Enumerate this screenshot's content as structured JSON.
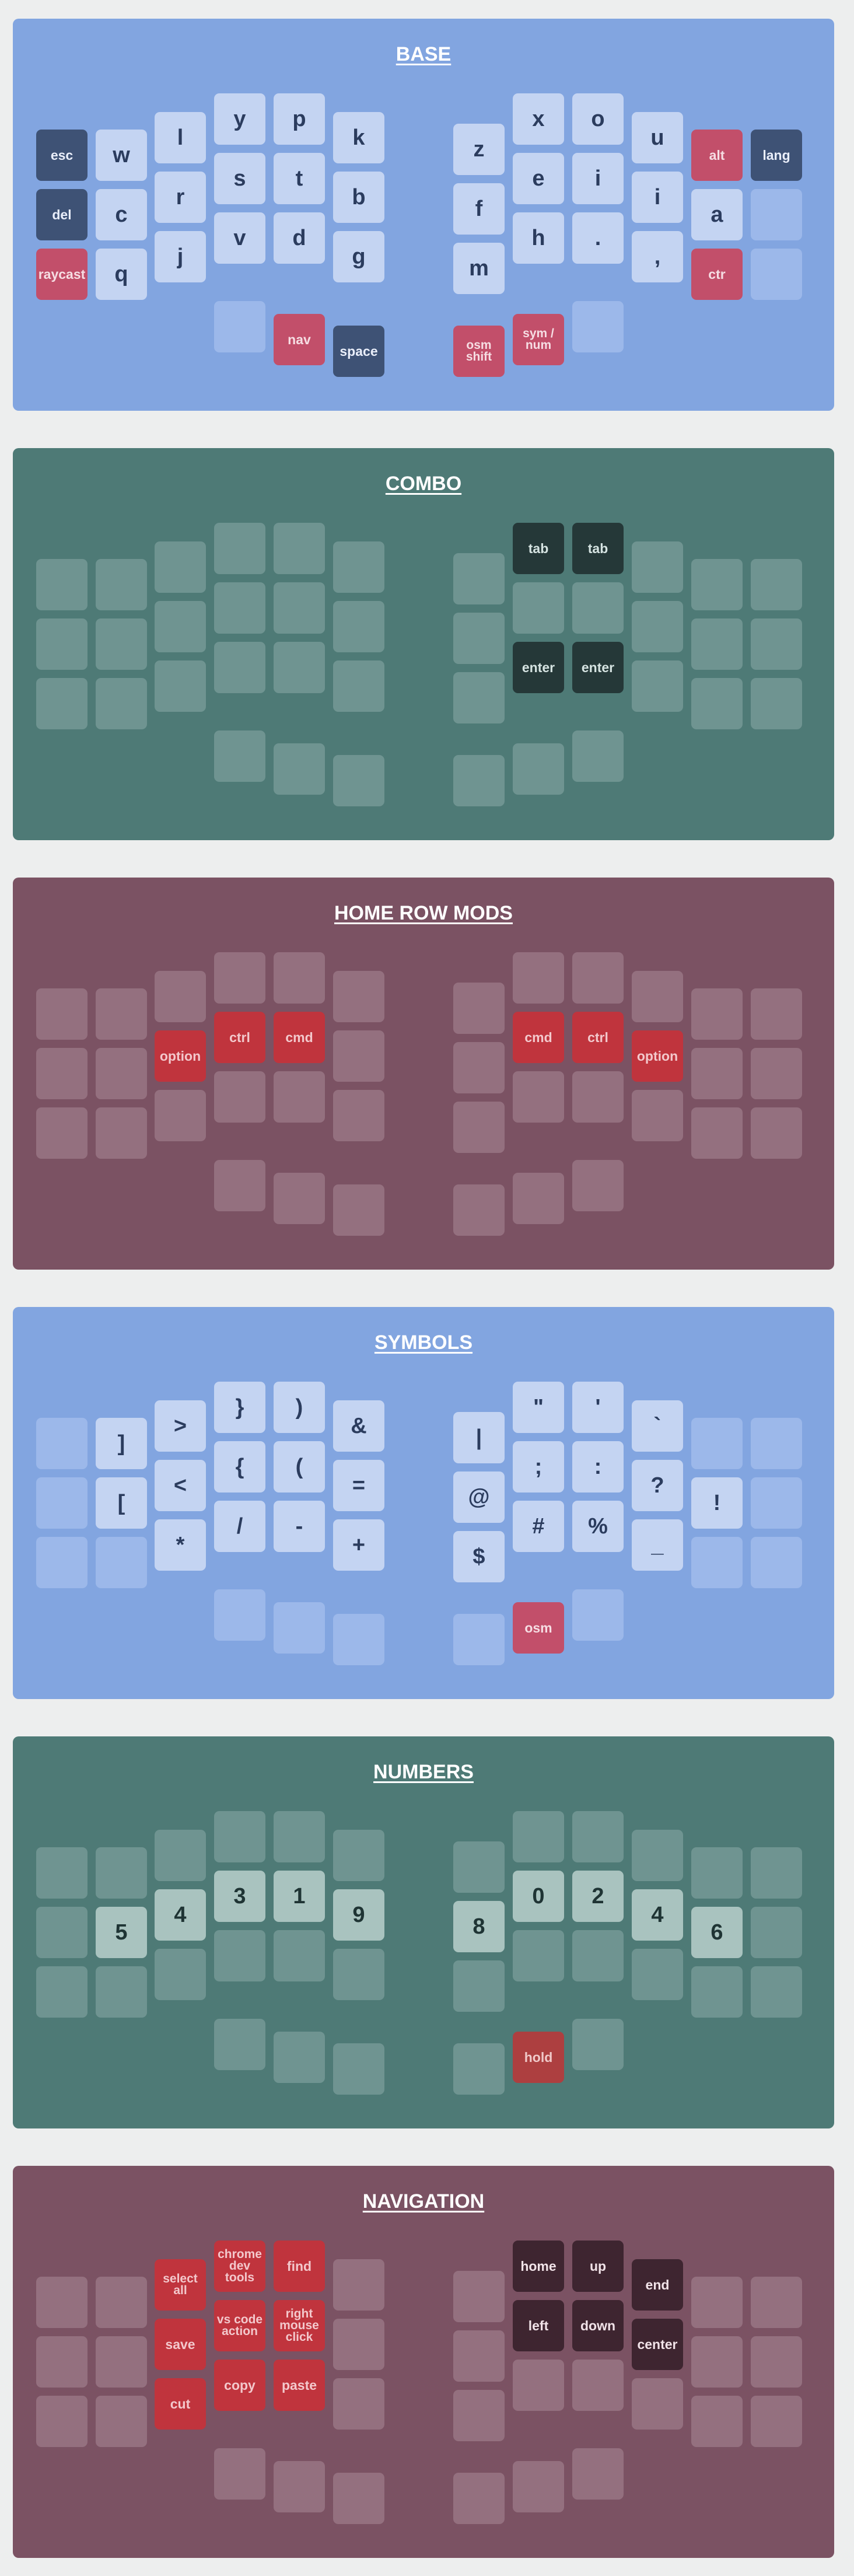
{
  "colors": {
    "page_bg": "#edeeee",
    "blue_panel": "#82a5e0",
    "teal_panel": "#4e7a76",
    "plum_panel": "#7b5263",
    "key_light_blue": "#c4d4f2",
    "key_dark_navy": "#3e5275",
    "key_pink": "#c24f6a",
    "key_red": "#c0343d",
    "key_teal_dark": "#253838",
    "key_mint": "#a9c3bf",
    "key_brick": "#ad3f40",
    "key_plum_dark": "#3e2530"
  },
  "layers": [
    {
      "title": "BASE",
      "left_outer": [
        "esc",
        "w",
        "del",
        "c",
        "raycast",
        "q"
      ],
      "left_main": [
        "l",
        "y",
        "p",
        "k",
        "r",
        "s",
        "t",
        "b",
        "j",
        "v",
        "d",
        "g"
      ],
      "left_thumbs": [
        "",
        "nav",
        "space"
      ],
      "right_main": [
        "z",
        "x",
        "o",
        "u",
        "f",
        "e",
        "i",
        "i",
        "m",
        "h",
        ".",
        ","
      ],
      "right_outer": [
        "alt",
        "lang",
        "a",
        "",
        "ctr",
        ""
      ],
      "right_thumbs": [
        "osm shift",
        "sym / num",
        ""
      ]
    },
    {
      "title": "COMBO",
      "left_outer": [
        "",
        "",
        "",
        "",
        "",
        ""
      ],
      "left_main": [
        "",
        "",
        "",
        "",
        "",
        "",
        "",
        "",
        "",
        "",
        "",
        ""
      ],
      "left_thumbs": [
        "",
        "",
        ""
      ],
      "right_main": [
        "",
        "tab",
        "tab",
        "",
        "",
        "",
        "",
        "",
        "",
        "enter",
        "enter",
        ""
      ],
      "right_outer": [
        "",
        "",
        "",
        "",
        "",
        ""
      ],
      "right_thumbs": [
        "",
        "",
        ""
      ]
    },
    {
      "title": "HOME ROW MODS",
      "left_outer": [
        "",
        "",
        "",
        "",
        "",
        ""
      ],
      "left_main": [
        "",
        "",
        "",
        "",
        "option",
        "ctrl",
        "cmd",
        "",
        "",
        "",
        "",
        ""
      ],
      "left_thumbs": [
        "",
        "",
        ""
      ],
      "right_main": [
        "",
        "",
        "",
        "",
        "",
        "cmd",
        "ctrl",
        "option",
        "",
        "",
        "",
        ""
      ],
      "right_outer": [
        "",
        "",
        "",
        "",
        "",
        ""
      ],
      "right_thumbs": [
        "",
        "",
        ""
      ]
    },
    {
      "title": "SYMBOLS",
      "left_outer": [
        "",
        "]",
        "",
        "[",
        "",
        ""
      ],
      "left_main": [
        ">",
        "}",
        ")",
        "&",
        "<",
        "{",
        "(",
        "=",
        "*",
        "/",
        "-",
        "+"
      ],
      "left_thumbs": [
        "",
        "",
        ""
      ],
      "right_main": [
        "|",
        "\"",
        "'",
        "`",
        "@",
        ";",
        ":",
        "?",
        "$",
        "#",
        "%",
        "_"
      ],
      "right_outer": [
        "",
        "",
        "!",
        "",
        "",
        ""
      ],
      "right_thumbs": [
        "",
        "osm",
        ""
      ]
    },
    {
      "title": "NUMBERS",
      "left_outer": [
        "",
        "",
        "",
        "5",
        "",
        ""
      ],
      "left_main": [
        "",
        "",
        "",
        "",
        "4",
        "3",
        "1",
        "9",
        "",
        "",
        "",
        ""
      ],
      "left_thumbs": [
        "",
        "",
        ""
      ],
      "right_main": [
        "",
        "",
        "",
        "",
        "8",
        "0",
        "2",
        "4",
        "",
        "",
        "",
        ""
      ],
      "right_outer": [
        "",
        "",
        "6",
        "",
        "",
        ""
      ],
      "right_thumbs": [
        "",
        "hold",
        ""
      ]
    },
    {
      "title": "NAVIGATION",
      "left_outer": [
        "",
        "",
        "",
        "",
        "",
        ""
      ],
      "left_main": [
        "select all",
        "chrome dev tools",
        "find",
        "",
        "save",
        "vs code action",
        "right mouse click",
        "",
        "cut",
        "copy",
        "paste",
        ""
      ],
      "left_thumbs": [
        "",
        "",
        ""
      ],
      "right_main": [
        "",
        "home",
        "up",
        "end",
        "",
        "left",
        "down",
        "center",
        "",
        "",
        "",
        ""
      ],
      "right_outer": [
        "",
        "",
        "",
        "",
        "",
        ""
      ],
      "right_thumbs": [
        "",
        "",
        ""
      ]
    }
  ]
}
